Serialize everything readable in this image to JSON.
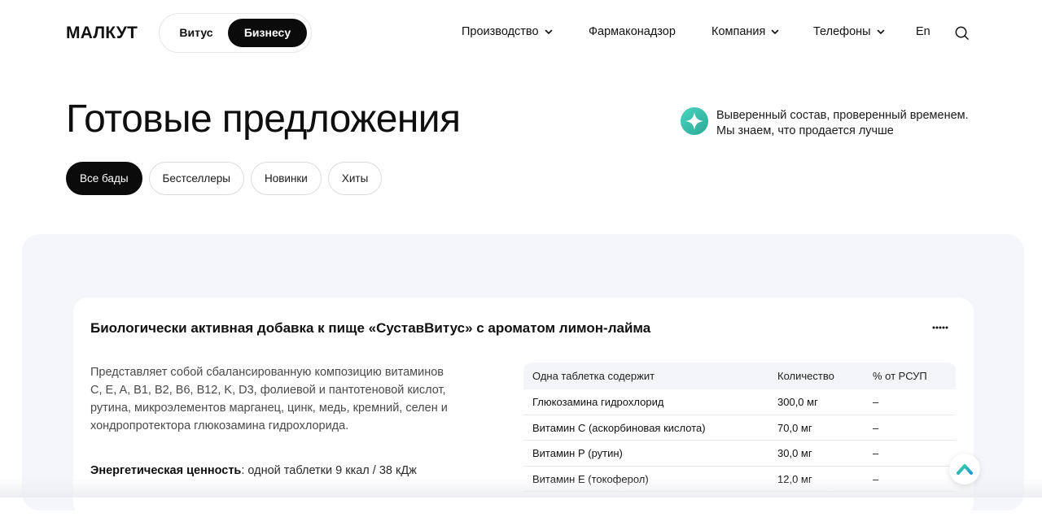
{
  "header": {
    "logo": "МАЛКУТ",
    "switch": {
      "option1": "Витус",
      "option2": "Бизнесу",
      "active": "Бизнесу"
    },
    "nav": [
      {
        "label": "Производство",
        "has_dropdown": true
      },
      {
        "label": "Фармаконадзор",
        "has_dropdown": false
      },
      {
        "label": "Компания",
        "has_dropdown": true
      },
      {
        "label": "Телефоны",
        "has_dropdown": true
      },
      {
        "label": "En",
        "has_dropdown": false
      }
    ],
    "search_icon": "search-icon"
  },
  "hero": {
    "title": "Готовые предложения",
    "promo_text": "Выверенный состав, проверенный временем. Мы знаем, что продается лучше",
    "promo_icon": "sparkle-icon",
    "promo_color": "#3dbfae"
  },
  "filters": [
    {
      "label": "Все бады",
      "active": true
    },
    {
      "label": "Бестселлеры",
      "active": false
    },
    {
      "label": "Новинки",
      "active": false
    },
    {
      "label": "Хиты",
      "active": false
    }
  ],
  "product": {
    "title": "Биологически активная добавка к пище «СуставВитус» с ароматом лимон-лайма",
    "description": "Представляет собой сбалансированную композицию витаминов C, E, A, B1, B2, B6, B12, K, D3, фолиевой и пантотеновой кислот, рутина, микроэлементов марганец, цинк, медь, кремний, селен и хондропротектора глюкозамина гидрохлорида.",
    "energy_label": "Энергетическая ценность",
    "energy_value": ": одной таблетки 9 ккал / 38 кДж",
    "composition": {
      "headers": [
        "Одна таблетка содержит",
        "Количество",
        "% от РСУП"
      ],
      "rows": [
        [
          "Глюкозамина гидрохлорид",
          "300,0 мг",
          "–"
        ],
        [
          "Витамин С (аскорбиновая кислота)",
          "70,0 мг",
          "–"
        ],
        [
          "Витамин Р (рутин)",
          "30,0 мг",
          "–"
        ],
        [
          "Витамин Е (токоферол)",
          "12,0 мг",
          "–"
        ]
      ]
    }
  },
  "colors": {
    "accent_dark": "#0b0b0b",
    "section_bg": "#f5f6fa",
    "brand_teal": "#3dbfae",
    "brand_green": "#22c55e"
  }
}
